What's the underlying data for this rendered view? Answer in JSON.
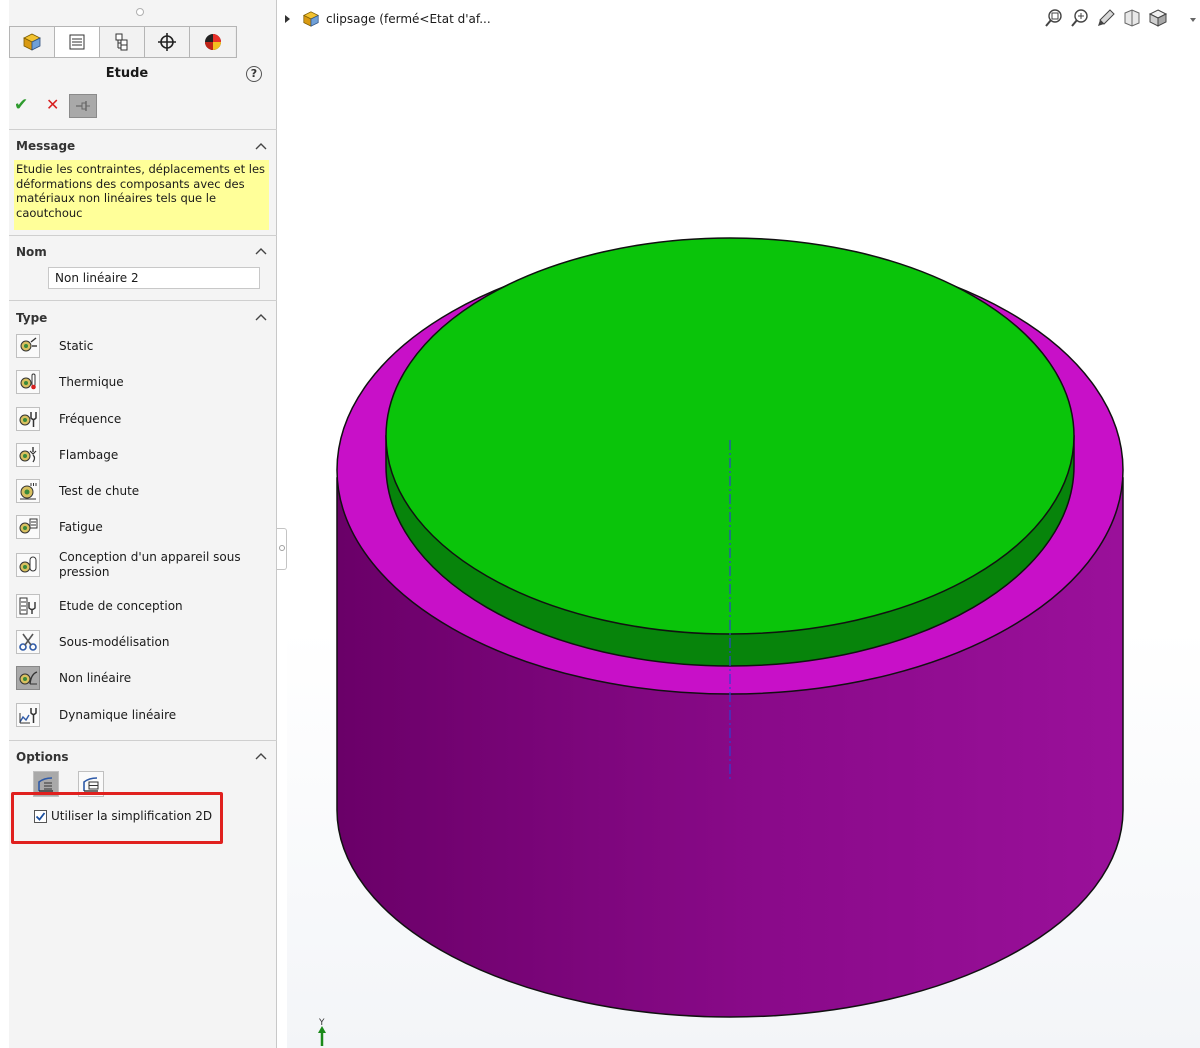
{
  "panel": {
    "title": "Etude",
    "help_glyph": "?",
    "ok_glyph": "✔",
    "cancel_glyph": "✕",
    "tabs": [
      {
        "icon": "part-cube-icon"
      },
      {
        "icon": "property-manager-icon"
      },
      {
        "icon": "configuration-manager-icon"
      },
      {
        "icon": "dimxpert-icon"
      },
      {
        "icon": "display-manager-icon"
      }
    ],
    "message": {
      "header": "Message",
      "text": "Etudie les contraintes, déplacements et les déformations des composants avec des matériaux non linéaires tels que le caoutchouc"
    },
    "name": {
      "header": "Nom",
      "value": "Non linéaire 2"
    },
    "type": {
      "header": "Type",
      "items": [
        {
          "label": "Static",
          "icon": "static-study-icon",
          "selected": false
        },
        {
          "label": "Thermique",
          "icon": "thermal-study-icon",
          "selected": false
        },
        {
          "label": "Fréquence",
          "icon": "frequency-study-icon",
          "selected": false
        },
        {
          "label": "Flambage",
          "icon": "buckling-study-icon",
          "selected": false
        },
        {
          "label": "Test de chute",
          "icon": "drop-test-study-icon",
          "selected": false
        },
        {
          "label": "Fatigue",
          "icon": "fatigue-study-icon",
          "selected": false
        },
        {
          "label": "Conception d'un appareil sous pression",
          "icon": "pressure-vessel-study-icon",
          "selected": false
        },
        {
          "label": "Etude de conception",
          "icon": "design-study-icon",
          "selected": false
        },
        {
          "label": "Sous-modélisation",
          "icon": "submodeling-study-icon",
          "selected": false
        },
        {
          "label": "Non linéaire",
          "icon": "nonlinear-study-icon",
          "selected": true
        },
        {
          "label": "Dynamique linéaire",
          "icon": "linear-dynamic-study-icon",
          "selected": false
        }
      ]
    },
    "options": {
      "header": "Options",
      "use_2d_simplification": {
        "label": "Utiliser la simplification 2D",
        "checked": true
      }
    }
  },
  "viewport": {
    "tree_title": "clipsage  (fermé<Etat d'af...",
    "triad_label": "Y",
    "colors": {
      "cylinder_top": "#c810c8",
      "cylinder_side": "#8a0a8a",
      "disk_top": "#0ac40a",
      "disk_side": "#07840b",
      "axis_line": "#2f3fd0"
    }
  }
}
